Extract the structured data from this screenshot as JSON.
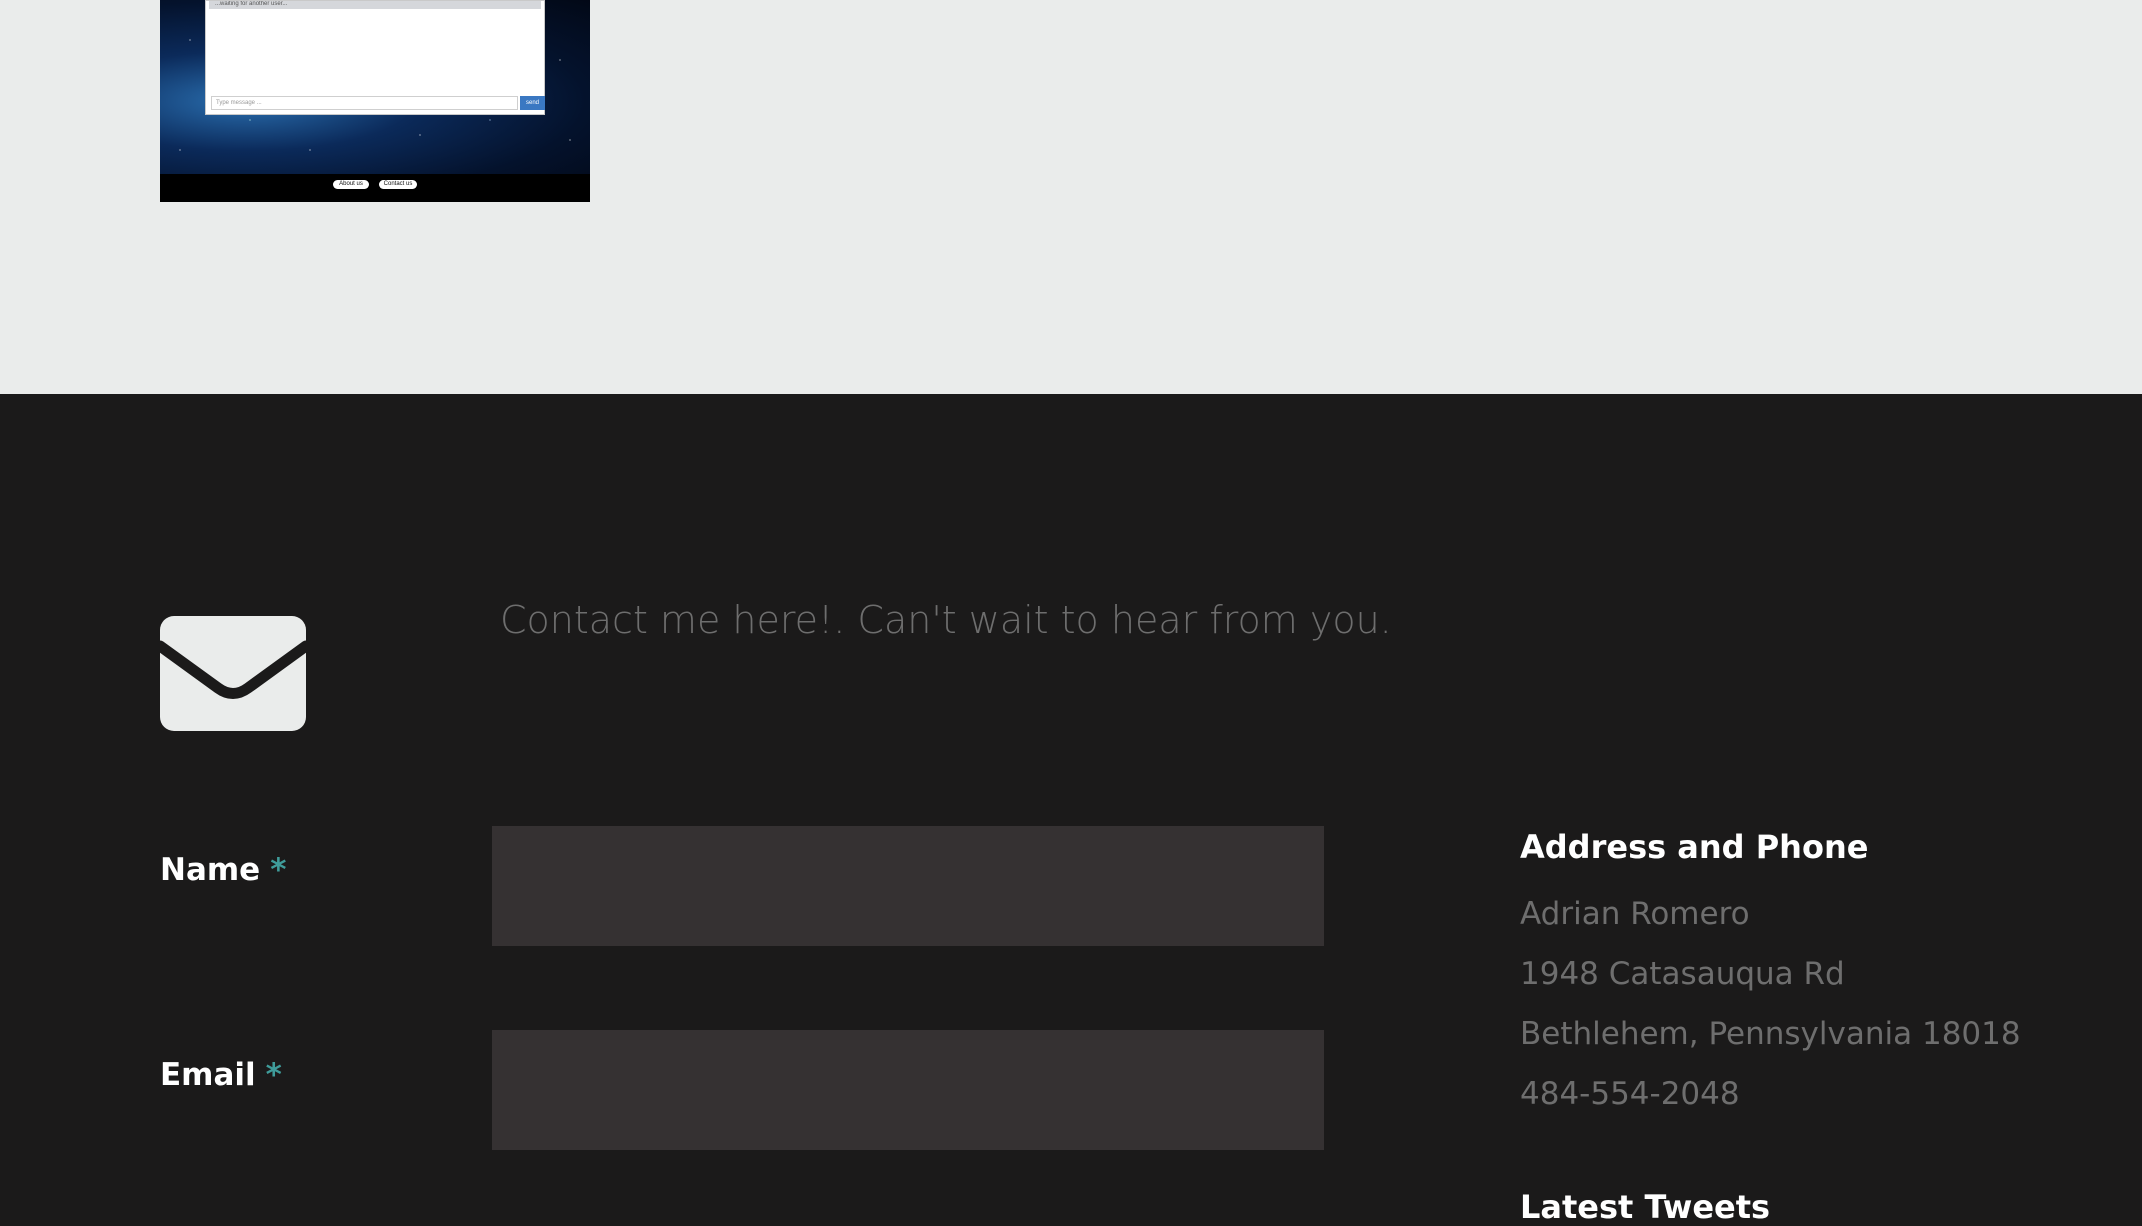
{
  "thumbnail": {
    "chat_status": "...waiting for another user...",
    "message_placeholder": "Type message ...",
    "send_label": "send",
    "footer_links": [
      "About us",
      "Contact us"
    ]
  },
  "contact": {
    "intro": "Contact me here!. Can't wait to hear from you.",
    "icon": "envelope-icon",
    "fields": {
      "name_label": "Name",
      "email_label": "Email",
      "required_marker": "*"
    }
  },
  "sidebar": {
    "address_heading": "Address and Phone",
    "name": "Adrian Romero",
    "street": "1948 Catasauqua Rd",
    "city": "Bethlehem, Pennsylvania 18018",
    "phone": "484-554-2048",
    "tweets_heading": "Latest Tweets"
  },
  "colors": {
    "page_light": "#eaeceb",
    "footer_dark": "#1b1a1a",
    "input_bg": "#353132",
    "required_accent": "#3f9c9a",
    "muted_text": "#6e6e6e"
  }
}
